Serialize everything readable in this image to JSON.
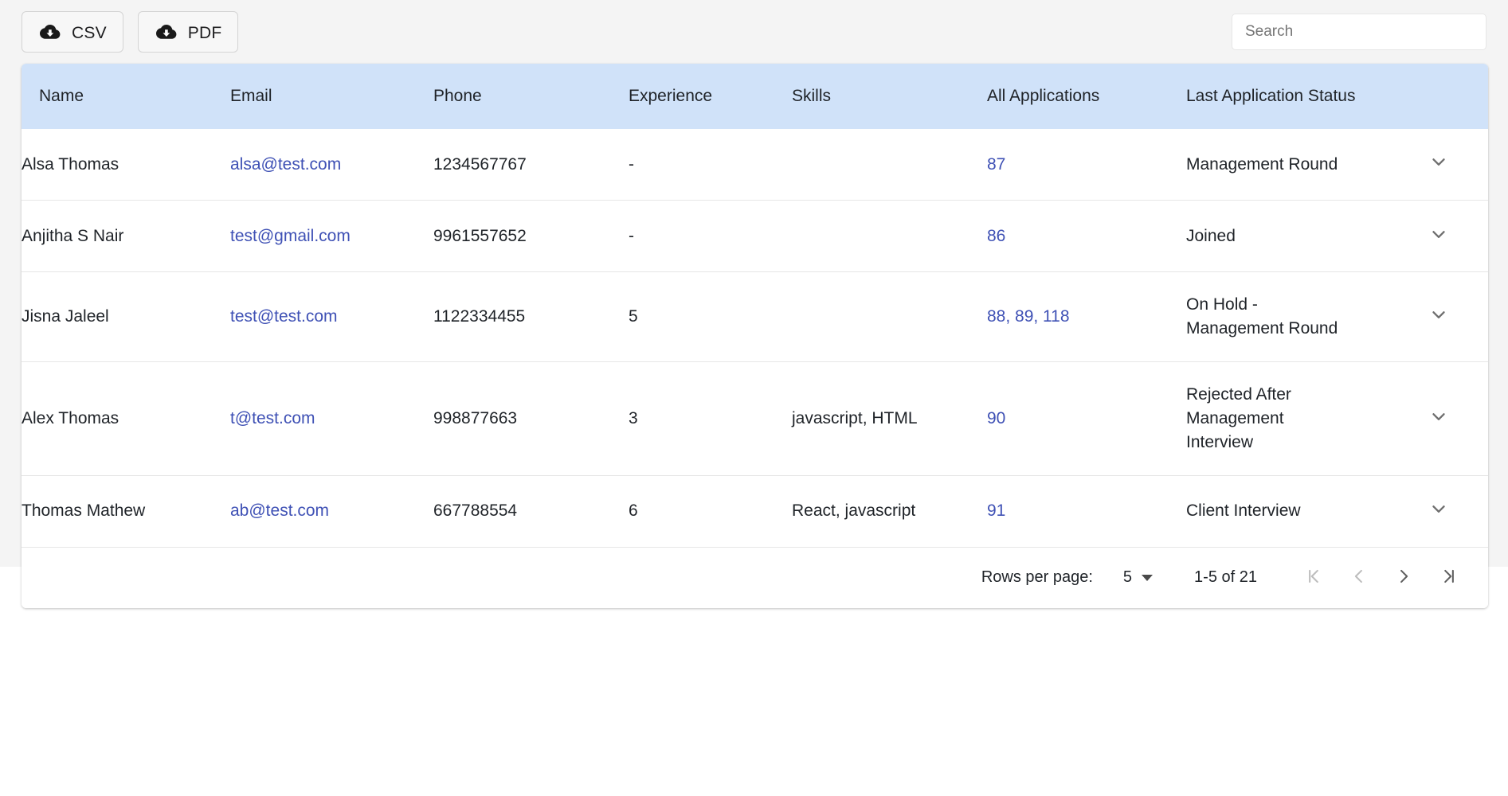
{
  "toolbar": {
    "export_csv_label": "CSV",
    "export_pdf_label": "PDF",
    "search_placeholder": "Search",
    "search_value": ""
  },
  "table": {
    "columns": [
      "Name",
      "Email",
      "Phone",
      "Experience",
      "Skills",
      "All Applications",
      "Last Application Status"
    ],
    "rows": [
      {
        "name": "Alsa Thomas",
        "email": "alsa@test.com",
        "phone": "1234567767",
        "experience": "-",
        "skills": "",
        "applications": "87",
        "status": "Management Round"
      },
      {
        "name": "Anjitha S Nair",
        "email": "test@gmail.com",
        "phone": "9961557652",
        "experience": "-",
        "skills": "",
        "applications": "86",
        "status": "Joined"
      },
      {
        "name": "Jisna Jaleel",
        "email": "test@test.com",
        "phone": "1122334455",
        "experience": "5",
        "skills": "",
        "applications": "88, 89, 118",
        "status": "On Hold - Management Round"
      },
      {
        "name": "Alex Thomas",
        "email": "t@test.com",
        "phone": "998877663",
        "experience": "3",
        "skills": "javascript, HTML",
        "applications": "90",
        "status": "Rejected After Management Interview"
      },
      {
        "name": "Thomas Mathew",
        "email": "ab@test.com",
        "phone": "667788554",
        "experience": "6",
        "skills": "React, javascript",
        "applications": "91",
        "status": "Client Interview"
      }
    ]
  },
  "pagination": {
    "rows_per_page_label": "Rows per page:",
    "rows_per_page_value": "5",
    "range_label": "1-5 of 21"
  },
  "colors": {
    "header_background": "#d0e2f9",
    "link": "#3f51b5",
    "page_background": "#f4f4f4",
    "text": "#1f2328"
  }
}
